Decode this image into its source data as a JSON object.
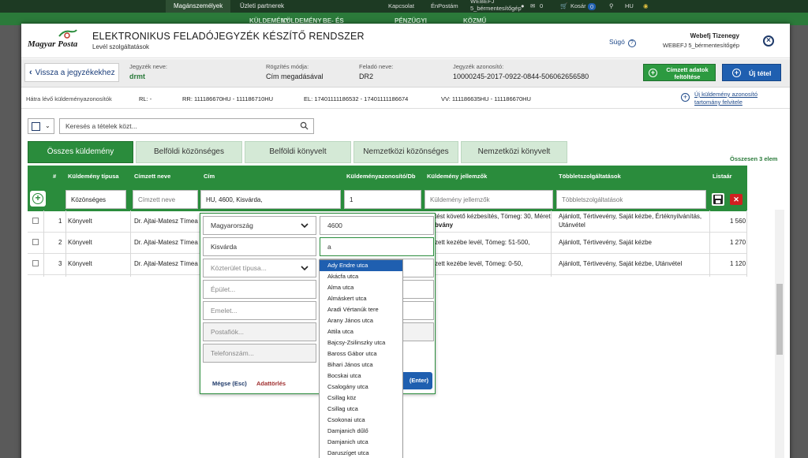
{
  "site": {
    "tabs": [
      "Magánszemélyek",
      "Üzleti partnerek"
    ],
    "menu": [
      "KÜLDEMÉNY",
      "KÜLDEMÉNY",
      "BE- ÉS",
      "PÉNZÜGYI",
      "KÖZMŰ"
    ],
    "right": {
      "kapcsolat": "Kapcsolat",
      "enpostam": "ÉnPostám",
      "user_line1": "WEBEFJ",
      "user_line2": "5_bérmentesítőgép",
      "msg_count": "0",
      "cart_label": "Kosár",
      "cart_count": "0",
      "lang": "HU"
    }
  },
  "modal": {
    "logo_text": "Magyar Posta",
    "title": "ELEKTRONIKUS FELADÓJEGYZÉK KÉSZÍTŐ RENDSZER",
    "subtitle": "Levél szolgáltatások",
    "help": "Súgó",
    "user_name": "Webefj Tizenegy",
    "user_sub": "WEBEFJ 5_bérmentesítőgép"
  },
  "info": {
    "back": "Vissza a jegyzékekhez",
    "list_name_label": "Jegyzék neve:",
    "list_name": "drmt",
    "record_mode_label": "Rögzítés módja:",
    "record_mode": "Cím megadásával",
    "sender_label": "Feladó neve:",
    "sender": "DR2",
    "list_id_label": "Jegyzék azonosító:",
    "list_id": "10000245-2017-0922-0844-506062656580",
    "upload_btn_l1": "Címzett adatok",
    "upload_btn_l2": "feltöltése",
    "new_item_btn": "Új tétel"
  },
  "ids": {
    "remaining_label": "Hátra lévő küldeményazonosítók",
    "rl": "RL: -",
    "rr": "RR: 111186670HU - 111186710HU",
    "el": "EL: 17401111186532 - 17401111186674",
    "vv": "VV: 111186635HU - 111186670HU",
    "new_range_l1": "Új küldemény azonosító",
    "new_range_l2": "tartomány felvitele"
  },
  "search": {
    "placeholder": "Keresés a tételek közt..."
  },
  "tabs": [
    "Összes küldemény",
    "Belföldi közönséges",
    "Belföldi könyvelt",
    "Nemzetközi közönséges",
    "Nemzetközi könyvelt"
  ],
  "total": "Összesen 3 elem",
  "grid": {
    "headers": [
      "#",
      "Küldemény típusa",
      "Címzett neve",
      "Cím",
      "Küldeményazonosító/Db",
      "Küldemény jellemzők",
      "Többletszolgáltatások",
      "Listaár"
    ],
    "filter": {
      "type": "Közönséges",
      "name_ph": "Címzett neve",
      "address": "HU, 4600, Kisvárda,",
      "qty": "1",
      "features_ph": "Küldemény jellemzők",
      "services_ph": "Többletszolgáltatások"
    },
    "rows": [
      {
        "n": "1",
        "type": "Könyvelt",
        "name": "Dr. Ajtai-Matesz Tímea",
        "features": "tést követő kézbesítés, Tömeg: 30, Méret:",
        "features2": "bvány",
        "services": "Ajánlott, Tértivevény, Saját kézbe, Értéknyilvánítás,",
        "services2": "Utánvétel",
        "price": "1 560"
      },
      {
        "n": "2",
        "type": "Könyvelt",
        "name": "Dr. Ajtai-Matesz Tímea",
        "features": "zett kezébe levél, Tömeg: 51-500,",
        "features2": "",
        "services": "Ajánlott, Tértivevény, Saját kézbe",
        "services2": "",
        "price": "1 270"
      },
      {
        "n": "3",
        "type": "Könyvelt",
        "name": "Dr. Ajtai-Matesz Tímea",
        "features": "zett kezébe levél, Tömeg: 0-50,",
        "features2": "",
        "services": "Ajánlott, Tértivevény, Saját kézbe, Utánvétel",
        "services2": "",
        "price": "1 120"
      }
    ]
  },
  "popup": {
    "country": "Magyarország",
    "zip": "4600",
    "city": "Kisvárda",
    "street": "a",
    "street_type_ph": "Közterület típusa...",
    "building_ph": "Épület...",
    "floor_ph": "Emelet...",
    "pobox_ph": "Postafiók...",
    "phone_ph": "Telefonszám...",
    "cancel": "Mégse (Esc)",
    "clear": "Adattörlés",
    "ok": "(Enter)"
  },
  "suggestions": [
    "Ady Endre utca",
    "Akácfa utca",
    "Alma utca",
    "Almáskert utca",
    "Aradi Vértanúk tere",
    "Arany János utca",
    "Attila utca",
    "Bajcsy-Zsilinszky utca",
    "Baross Gábor utca",
    "Bihari János utca",
    "Bocskai utca",
    "Csalogány utca",
    "Csillag köz",
    "Csillag utca",
    "Csokonai utca",
    "Damjanich dűlő",
    "Damjanich utca",
    "Daruszíget utca"
  ],
  "colors": {
    "green": "#2a8c3c",
    "blue": "#1f5fb0",
    "dark": "#1d3a23"
  }
}
